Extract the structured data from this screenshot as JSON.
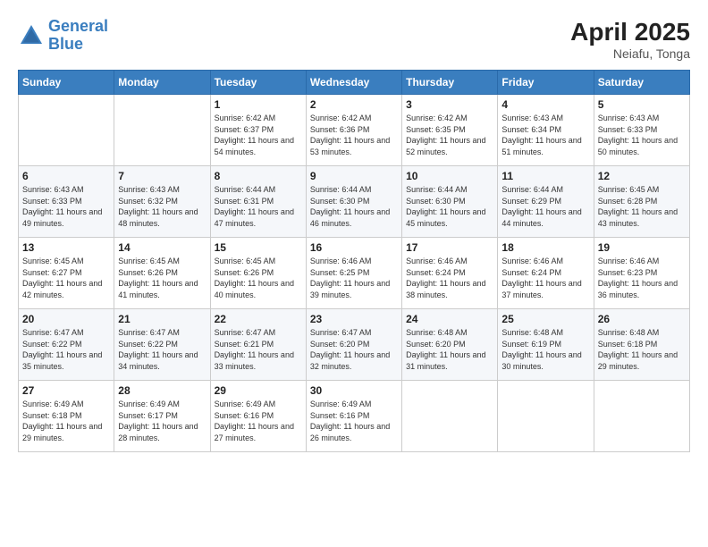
{
  "header": {
    "logo_line1": "General",
    "logo_line2": "Blue",
    "month_year": "April 2025",
    "location": "Neiafu, Tonga"
  },
  "weekdays": [
    "Sunday",
    "Monday",
    "Tuesday",
    "Wednesday",
    "Thursday",
    "Friday",
    "Saturday"
  ],
  "weeks": [
    [
      {
        "day": "",
        "info": ""
      },
      {
        "day": "",
        "info": ""
      },
      {
        "day": "1",
        "info": "Sunrise: 6:42 AM\nSunset: 6:37 PM\nDaylight: 11 hours and 54 minutes."
      },
      {
        "day": "2",
        "info": "Sunrise: 6:42 AM\nSunset: 6:36 PM\nDaylight: 11 hours and 53 minutes."
      },
      {
        "day": "3",
        "info": "Sunrise: 6:42 AM\nSunset: 6:35 PM\nDaylight: 11 hours and 52 minutes."
      },
      {
        "day": "4",
        "info": "Sunrise: 6:43 AM\nSunset: 6:34 PM\nDaylight: 11 hours and 51 minutes."
      },
      {
        "day": "5",
        "info": "Sunrise: 6:43 AM\nSunset: 6:33 PM\nDaylight: 11 hours and 50 minutes."
      }
    ],
    [
      {
        "day": "6",
        "info": "Sunrise: 6:43 AM\nSunset: 6:33 PM\nDaylight: 11 hours and 49 minutes."
      },
      {
        "day": "7",
        "info": "Sunrise: 6:43 AM\nSunset: 6:32 PM\nDaylight: 11 hours and 48 minutes."
      },
      {
        "day": "8",
        "info": "Sunrise: 6:44 AM\nSunset: 6:31 PM\nDaylight: 11 hours and 47 minutes."
      },
      {
        "day": "9",
        "info": "Sunrise: 6:44 AM\nSunset: 6:30 PM\nDaylight: 11 hours and 46 minutes."
      },
      {
        "day": "10",
        "info": "Sunrise: 6:44 AM\nSunset: 6:30 PM\nDaylight: 11 hours and 45 minutes."
      },
      {
        "day": "11",
        "info": "Sunrise: 6:44 AM\nSunset: 6:29 PM\nDaylight: 11 hours and 44 minutes."
      },
      {
        "day": "12",
        "info": "Sunrise: 6:45 AM\nSunset: 6:28 PM\nDaylight: 11 hours and 43 minutes."
      }
    ],
    [
      {
        "day": "13",
        "info": "Sunrise: 6:45 AM\nSunset: 6:27 PM\nDaylight: 11 hours and 42 minutes."
      },
      {
        "day": "14",
        "info": "Sunrise: 6:45 AM\nSunset: 6:26 PM\nDaylight: 11 hours and 41 minutes."
      },
      {
        "day": "15",
        "info": "Sunrise: 6:45 AM\nSunset: 6:26 PM\nDaylight: 11 hours and 40 minutes."
      },
      {
        "day": "16",
        "info": "Sunrise: 6:46 AM\nSunset: 6:25 PM\nDaylight: 11 hours and 39 minutes."
      },
      {
        "day": "17",
        "info": "Sunrise: 6:46 AM\nSunset: 6:24 PM\nDaylight: 11 hours and 38 minutes."
      },
      {
        "day": "18",
        "info": "Sunrise: 6:46 AM\nSunset: 6:24 PM\nDaylight: 11 hours and 37 minutes."
      },
      {
        "day": "19",
        "info": "Sunrise: 6:46 AM\nSunset: 6:23 PM\nDaylight: 11 hours and 36 minutes."
      }
    ],
    [
      {
        "day": "20",
        "info": "Sunrise: 6:47 AM\nSunset: 6:22 PM\nDaylight: 11 hours and 35 minutes."
      },
      {
        "day": "21",
        "info": "Sunrise: 6:47 AM\nSunset: 6:22 PM\nDaylight: 11 hours and 34 minutes."
      },
      {
        "day": "22",
        "info": "Sunrise: 6:47 AM\nSunset: 6:21 PM\nDaylight: 11 hours and 33 minutes."
      },
      {
        "day": "23",
        "info": "Sunrise: 6:47 AM\nSunset: 6:20 PM\nDaylight: 11 hours and 32 minutes."
      },
      {
        "day": "24",
        "info": "Sunrise: 6:48 AM\nSunset: 6:20 PM\nDaylight: 11 hours and 31 minutes."
      },
      {
        "day": "25",
        "info": "Sunrise: 6:48 AM\nSunset: 6:19 PM\nDaylight: 11 hours and 30 minutes."
      },
      {
        "day": "26",
        "info": "Sunrise: 6:48 AM\nSunset: 6:18 PM\nDaylight: 11 hours and 29 minutes."
      }
    ],
    [
      {
        "day": "27",
        "info": "Sunrise: 6:49 AM\nSunset: 6:18 PM\nDaylight: 11 hours and 29 minutes."
      },
      {
        "day": "28",
        "info": "Sunrise: 6:49 AM\nSunset: 6:17 PM\nDaylight: 11 hours and 28 minutes."
      },
      {
        "day": "29",
        "info": "Sunrise: 6:49 AM\nSunset: 6:16 PM\nDaylight: 11 hours and 27 minutes."
      },
      {
        "day": "30",
        "info": "Sunrise: 6:49 AM\nSunset: 6:16 PM\nDaylight: 11 hours and 26 minutes."
      },
      {
        "day": "",
        "info": ""
      },
      {
        "day": "",
        "info": ""
      },
      {
        "day": "",
        "info": ""
      }
    ]
  ]
}
